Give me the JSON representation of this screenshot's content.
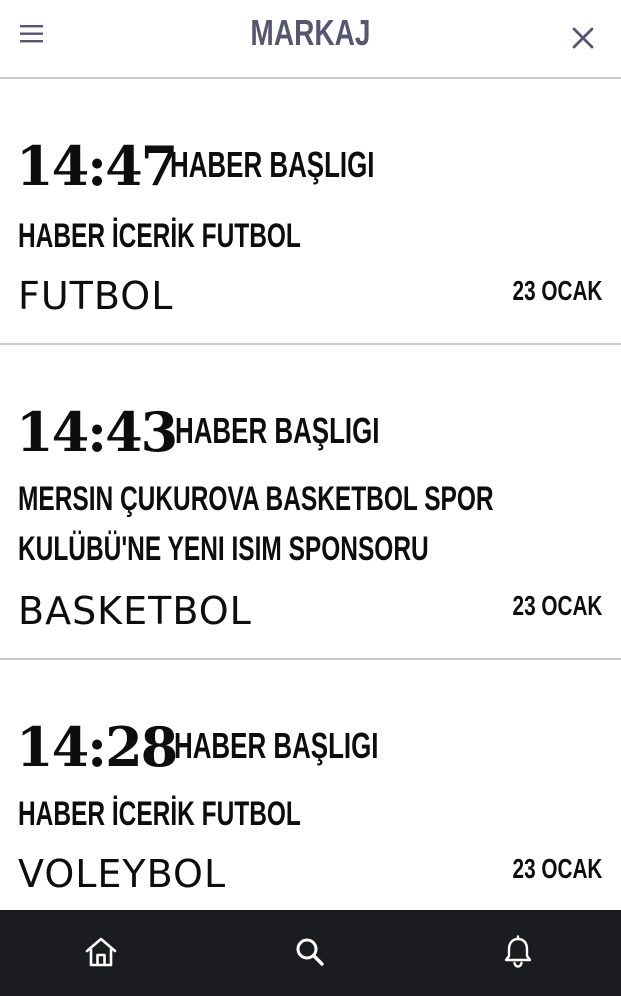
{
  "header": {
    "logo": "MARKAJ",
    "menu_icon": "hamburger-menu-icon",
    "close_icon": "close-icon"
  },
  "news": [
    {
      "time": "14:47",
      "headline": "HABER BAŞLIGI",
      "summary": "HABER İCERİK FUTBOL",
      "category": "FUTBOL",
      "date": "23 OCAK"
    },
    {
      "time": "14:43",
      "headline": "HABER BAŞLIGI",
      "summary": "MERSIN ÇUKUROVA BASKETBOL SPOR KULÜBÜ'NE YENI ISIM SPONSORU",
      "category": "BASKETBOL",
      "date": "23 OCAK"
    },
    {
      "time": "14:28",
      "headline": "HABER BAŞLIGI",
      "summary": "HABER İCERİK FUTBOL",
      "category": "VOLEYBOL",
      "date": "23 OCAK"
    }
  ],
  "bottom_nav": [
    {
      "icon": "home-icon"
    },
    {
      "icon": "search-icon"
    },
    {
      "icon": "bell-icon"
    }
  ],
  "colors": {
    "logo": "#55566f",
    "text": "#0d0d0d",
    "divider": "#c9c9c9",
    "bottom_bar": "#1b1c1f",
    "nav_icon": "#ffffff"
  }
}
